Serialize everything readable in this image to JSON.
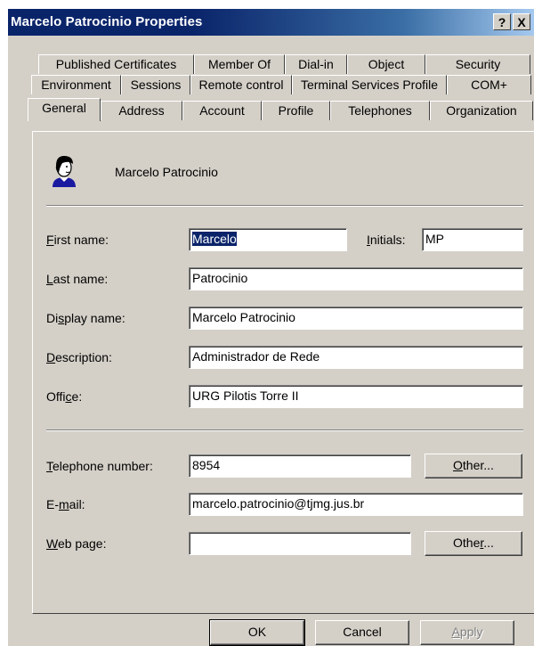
{
  "window": {
    "title": "Marcelo Patrocinio Properties",
    "help_label": "?",
    "close_label": "X"
  },
  "tabs": {
    "row1": [
      "Published Certificates",
      "Member Of",
      "Dial-in",
      "Object",
      "Security"
    ],
    "row2": [
      "Environment",
      "Sessions",
      "Remote control",
      "Terminal Services Profile",
      "COM+"
    ],
    "row3": [
      "General",
      "Address",
      "Account",
      "Profile",
      "Telephones",
      "Organization"
    ],
    "active": "General"
  },
  "header": {
    "user_icon": "user-icon",
    "name": "Marcelo Patrocinio"
  },
  "fields": {
    "first_name": {
      "label_pre": "",
      "label_key": "F",
      "label_post": "irst name:",
      "value": "Marcelo"
    },
    "initials": {
      "label_pre": "",
      "label_key": "I",
      "label_post": "nitials:",
      "value": "MP"
    },
    "last_name": {
      "label_pre": "",
      "label_key": "L",
      "label_post": "ast name:",
      "value": "Patrocinio"
    },
    "display_name": {
      "label_pre": "Di",
      "label_key": "s",
      "label_post": "play name:",
      "value": "Marcelo Patrocinio"
    },
    "description": {
      "label_pre": "",
      "label_key": "D",
      "label_post": "escription:",
      "value": "Administrador de Rede"
    },
    "office": {
      "label_pre": "Offi",
      "label_key": "c",
      "label_post": "e:",
      "value": "URG Pilotis Torre II"
    },
    "telephone": {
      "label_pre": "",
      "label_key": "T",
      "label_post": "elephone number:",
      "value": "8954"
    },
    "email": {
      "label_pre": "E-",
      "label_key": "m",
      "label_post": "ail:",
      "value": "marcelo.patrocinio@tjmg.jus.br"
    },
    "web_page": {
      "label_pre": "",
      "label_key": "W",
      "label_post": "eb page:",
      "value": ""
    }
  },
  "buttons": {
    "other_phone": {
      "pre": "",
      "key": "O",
      "post": "ther..."
    },
    "other_web": {
      "pre": "Othe",
      "key": "r",
      "post": "..."
    },
    "ok": "OK",
    "cancel": "Cancel",
    "apply": {
      "pre": "",
      "key": "A",
      "post": "pply"
    }
  },
  "colors": {
    "title_bar": "#0a246a",
    "dialog_bg": "#d4d0c8",
    "selection": "#0a246a"
  }
}
